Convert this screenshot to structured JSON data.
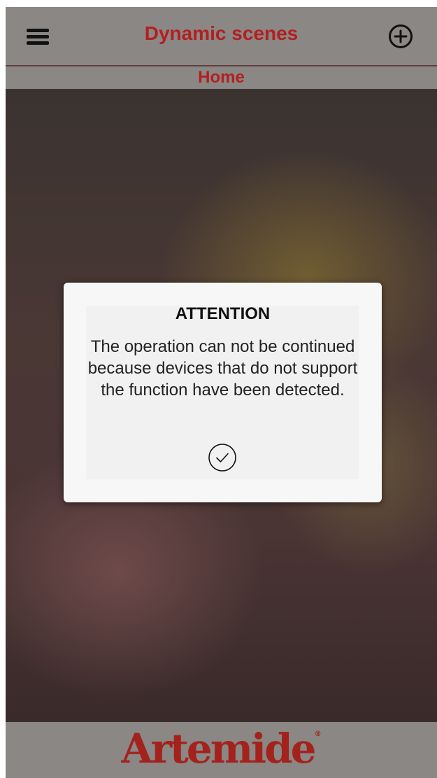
{
  "header": {
    "title": "Dynamic scenes",
    "menu_icon": "hamburger-menu-icon",
    "add_icon": "plus-circle-icon"
  },
  "subheader": {
    "breadcrumb": "Home"
  },
  "modal": {
    "title": "ATTENTION",
    "message": "The operation can not be continued because devices that do not support the function have been detected.",
    "confirm_icon": "check-circle-icon"
  },
  "footer": {
    "logo_text": "Artemide",
    "logo_mark": "®"
  },
  "colors": {
    "accent": "#b31f1f",
    "bar": "#8a8785",
    "logo": "#a3231c"
  }
}
